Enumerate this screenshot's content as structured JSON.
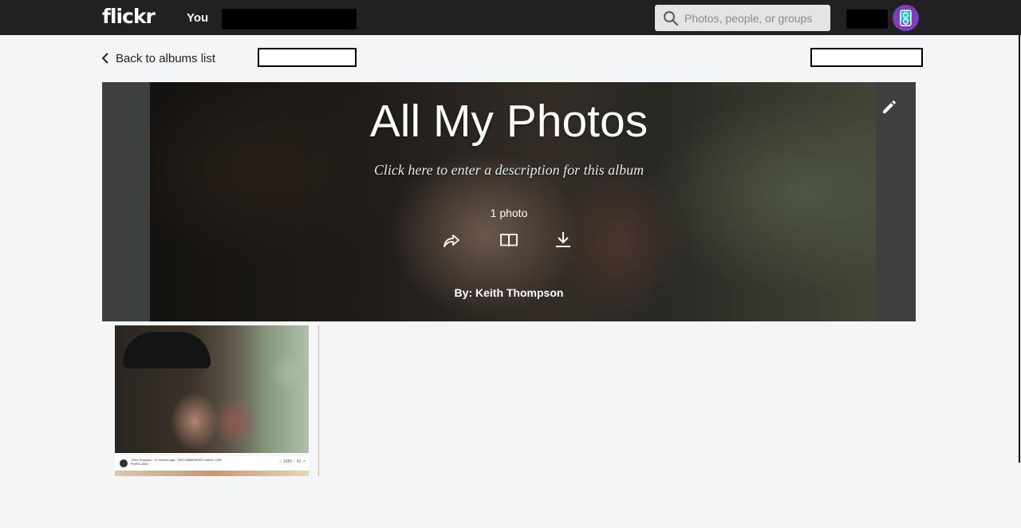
{
  "topbar": {
    "logo": "flickr",
    "nav_you": "You",
    "search_placeholder": "Photos, people, or groups"
  },
  "subheader": {
    "back_label": "Back to albums list"
  },
  "album": {
    "title": "All My Photos",
    "description_prompt": "Click here to enter a description for this album",
    "photo_count": "1 photo",
    "byline": "By: Keith Thompson"
  },
  "thumbnail": {
    "footer_text": "Théo Gosselin · 11 months ago · RECOMMENDED MAUD CAR PORTLAND",
    "stats": "☆ 1985 ◌ 42 ↗"
  },
  "icons": {
    "search": "search-icon",
    "back": "chevron-left-icon",
    "edit": "pencil-icon",
    "share": "share-arrow-icon",
    "book": "open-book-icon",
    "download": "download-icon",
    "avatar": "avatar"
  },
  "colors": {
    "topbar_bg": "#212124",
    "page_bg": "#f3f5f6",
    "search_bg": "#e2e4e6"
  }
}
